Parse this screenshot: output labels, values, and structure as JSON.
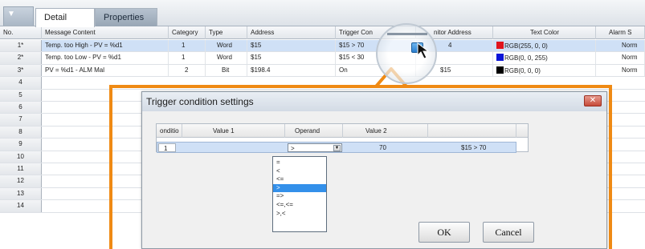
{
  "tabs": {
    "arrow": "▼",
    "detail": "Detail",
    "properties": "Properties"
  },
  "grid": {
    "headers": {
      "no": "No.",
      "message": "Message Content",
      "category": "Category",
      "type": "Type",
      "address": "Address",
      "trigger": "Trigger Con",
      "monitor": "nitor Address",
      "text_color": "Text Color",
      "alarm": "Alarm S"
    },
    "rows": [
      {
        "no": "1*",
        "message": "Temp. too High - PV = %d1",
        "category": "1",
        "type": "Word",
        "address": "$15",
        "trigger": "$15 > 70",
        "monitor": "4",
        "color_text": "RGB(255, 0, 0)",
        "color": "#e0141c",
        "alarm": "Norm"
      },
      {
        "no": "2*",
        "message": "Temp. too Low - PV = %d1",
        "category": "1",
        "type": "Word",
        "address": "$15",
        "trigger": "$15 < 30",
        "monitor": "",
        "color_text": "RGB(0, 0, 255)",
        "color": "#0a14d8",
        "alarm": "Norm"
      },
      {
        "no": "3*",
        "message": "PV = %d1 - ALM Mal",
        "category": "2",
        "type": "Bit",
        "address": "$198.4",
        "trigger": "On",
        "monitor": "$15",
        "color_text": "RGB(0, 0, 0)",
        "color": "#000000",
        "alarm": "Norm"
      },
      {
        "no": "4"
      },
      {
        "no": "5"
      },
      {
        "no": "6"
      },
      {
        "no": "7"
      },
      {
        "no": "8"
      },
      {
        "no": "9"
      },
      {
        "no": "10"
      },
      {
        "no": "11"
      },
      {
        "no": "12"
      },
      {
        "no": "13"
      },
      {
        "no": "14"
      }
    ]
  },
  "dialog": {
    "title": "Trigger condition settings",
    "close": "✕",
    "table_headers": {
      "condition": "onditio",
      "value1": "Value 1",
      "operand": "Operand",
      "value2": "Value 2"
    },
    "row": {
      "index": "1",
      "value1": "",
      "operand": ">",
      "value2": "70",
      "result": "$15 > 70"
    },
    "operand_options": [
      "=",
      "<",
      "<=",
      ">",
      "=>",
      "<=,<=",
      ">,<"
    ],
    "selected_option": ">",
    "ok": "OK",
    "cancel": "Cancel"
  },
  "colors": {
    "accent_orange": "#ef8a14",
    "selection_blue": "#3390ea",
    "row_highlight": "#cfe0f6"
  }
}
